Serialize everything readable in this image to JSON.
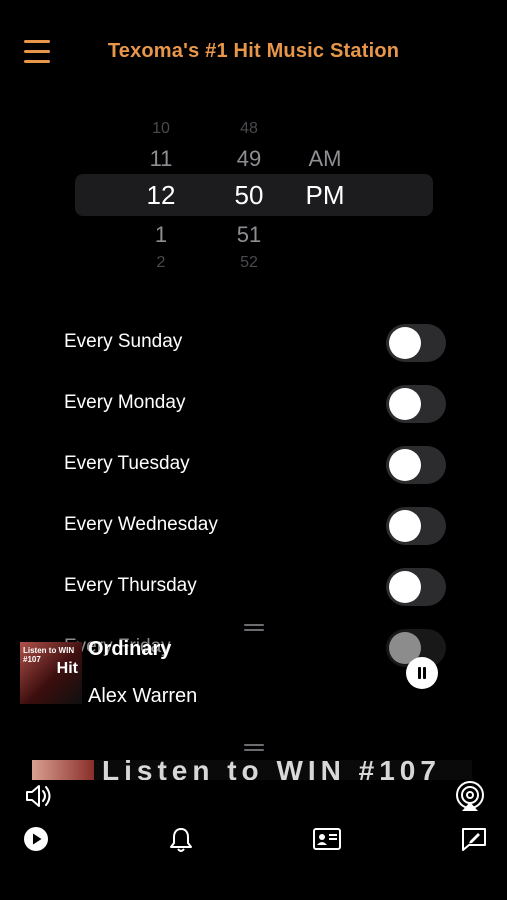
{
  "header": {
    "title": "Texoma's #1 Hit Music Station",
    "accent_color": "#e8974a",
    "menu_icon": "hamburger-menu-icon"
  },
  "time_picker": {
    "hours": [
      "10",
      "11",
      "12",
      "1",
      "2"
    ],
    "minutes": [
      "48",
      "49",
      "50",
      "51",
      "52"
    ],
    "periods": [
      "AM",
      "PM"
    ],
    "selected": {
      "hour": "12",
      "minute": "50",
      "period": "PM"
    }
  },
  "schedule": {
    "days": [
      {
        "label": "Every Sunday",
        "on": false
      },
      {
        "label": "Every Monday",
        "on": false
      },
      {
        "label": "Every Tuesday",
        "on": false
      },
      {
        "label": "Every Wednesday",
        "on": false
      },
      {
        "label": "Every Thursday",
        "on": false
      },
      {
        "label": "Every Friday",
        "on": false
      }
    ]
  },
  "now_playing": {
    "title": "Ordinary",
    "artist": "Alex Warren",
    "art_text": "Listen to WIN #107",
    "art_hit": "Hit"
  },
  "banner": {
    "text": "Listen to WIN #107"
  },
  "toolbar": {
    "icons": [
      "volume-icon",
      "airplay-icon",
      "play-icon",
      "bell-icon",
      "contact-card-icon",
      "compose-icon"
    ]
  }
}
